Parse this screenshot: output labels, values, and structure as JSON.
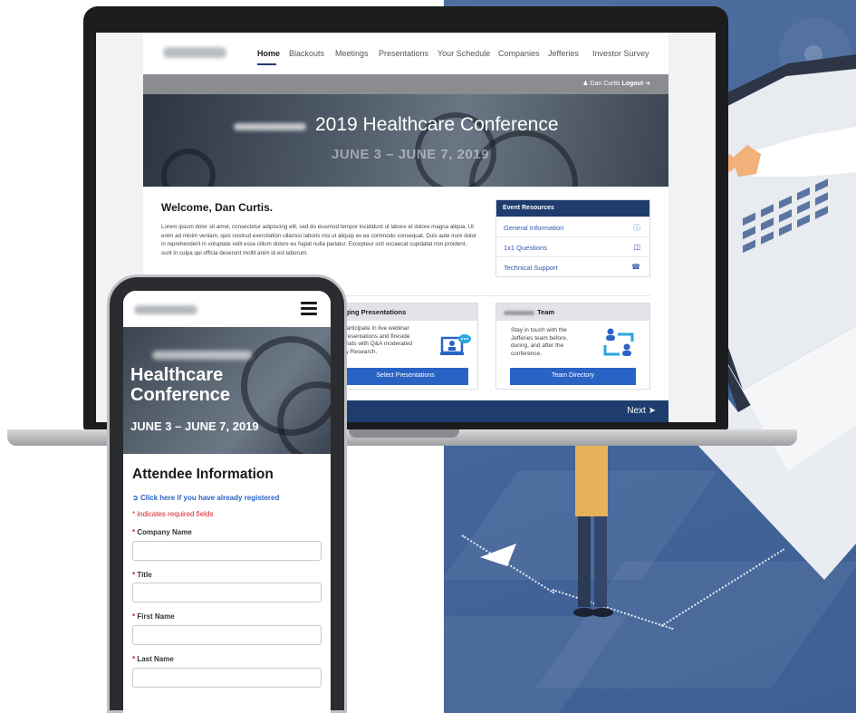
{
  "desktop": {
    "nav": {
      "items": [
        "Home",
        "Blackouts",
        "Meetings",
        "Presentations",
        "Your Schedule",
        "Companies",
        "Jefferies",
        "Investor Survey"
      ],
      "active": "Home"
    },
    "user": {
      "name": "Dan Curtis",
      "logout": "Logout"
    },
    "hero": {
      "title": "2019 Healthcare Conference",
      "dates": "JUNE 3 – JUNE 7, 2019"
    },
    "welcome": {
      "heading": "Welcome, Dan Curtis.",
      "body": "Lorem ipsum dolor sit amet, consectetur adipiscing elit, sed do eiusmod tempor incididunt ut labore et dolore magna aliqua. Ut enim ad minim veniam, quis nostrud exercitation ullamco laboris nisi ut aliquip ex ea commodo consequat. Duis aute irure dolor in reprehenderit in voluptate velit esse cillum dolore eu fugiat nulla pariatur. Excepteur sint occaecat cupidatat non proident, sunt in culpa qui officia deserunt mollit anim id est laborum."
    },
    "resources": {
      "title": "Event Resources",
      "items": [
        {
          "label": "General Information",
          "icon": "info-icon"
        },
        {
          "label": "1x1 Questions",
          "icon": "ticket-icon"
        },
        {
          "label": "Technical Support",
          "icon": "support-icon"
        }
      ]
    },
    "presentations_card": {
      "title": "gaging Presentations",
      "text_lines": [
        "Participate in live webinar",
        "presentations and fireside",
        "chats with Q&A moderated",
        "by Research."
      ],
      "button": "Select Presentations"
    },
    "team_card": {
      "title": "Team",
      "text_lines": [
        "Stay in touch with the",
        "Jefferies team before,",
        "during, and after the",
        "conference."
      ],
      "button": "Team Directory"
    },
    "footer": {
      "next": "Next"
    }
  },
  "mobile": {
    "hero": {
      "title": "Healthcare Conference",
      "dates": "JUNE 3 – JUNE 7, 2019"
    },
    "form": {
      "heading": "Attendee Information",
      "registered_link": "Click here if you have already registered",
      "required_note": "* indicates required fields",
      "fields": [
        {
          "label": "Company Name",
          "value": ""
        },
        {
          "label": "Title",
          "value": ""
        },
        {
          "label": "First Name",
          "value": ""
        },
        {
          "label": "Last Name",
          "value": ""
        }
      ]
    }
  },
  "colors": {
    "navy": "#1f3c6e",
    "button_blue": "#2a63c6",
    "link_blue": "#2b5aa8",
    "required_red": "#d61f1f",
    "illustration_bg": "#44669a"
  }
}
